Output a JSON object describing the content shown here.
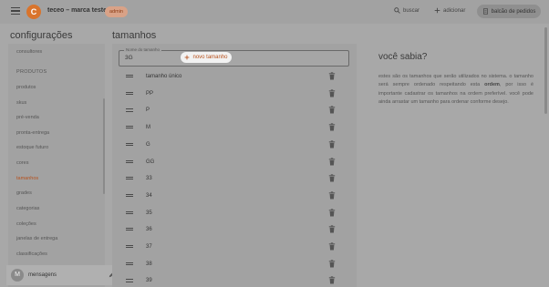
{
  "topbar": {
    "avatar_letter": "C",
    "store_name": "teceo – marca teste",
    "role_badge": "admin",
    "search_label": "buscar",
    "add_label": "adicionar",
    "store_button_label": "balcão de pedidos"
  },
  "sidebar": {
    "title": "configurações",
    "items_top": [
      {
        "label": "consultores"
      }
    ],
    "section_label": "PRODUTOS",
    "items": [
      {
        "label": "produtos"
      },
      {
        "label": "skus"
      },
      {
        "label": "pré-venda"
      },
      {
        "label": "pronta-entrega"
      },
      {
        "label": "estoque futuro"
      },
      {
        "label": "cores"
      },
      {
        "label": "tamanhos"
      },
      {
        "label": "grades"
      },
      {
        "label": "categorias"
      },
      {
        "label": "coleções"
      },
      {
        "label": "janelas de entrega"
      },
      {
        "label": "classificações"
      }
    ],
    "active_item": "tamanhos"
  },
  "messages": {
    "avatar_letter": "M",
    "label": "mensagens"
  },
  "main": {
    "title": "tamanhos",
    "field": {
      "label": "Nome do tamanho",
      "value": "3G"
    },
    "new_button_label": "novo tamanho",
    "rows": [
      {
        "label": "tamanho único"
      },
      {
        "label": "PP"
      },
      {
        "label": "P"
      },
      {
        "label": "M"
      },
      {
        "label": "G"
      },
      {
        "label": "GG"
      },
      {
        "label": "33"
      },
      {
        "label": "34"
      },
      {
        "label": "35"
      },
      {
        "label": "36"
      },
      {
        "label": "37"
      },
      {
        "label": "38"
      },
      {
        "label": "39"
      }
    ]
  },
  "info": {
    "title": "você sabia?",
    "text_1": "estes são os tamanhos que serão utilizados no sistema. o tamanho será sempre ordenado respeitando esta ",
    "text_bold": "ordem",
    "text_2": ", por isso é importante cadastrar os tamanhos na ordem preferível. você pode ainda arrastar um tamanho para ordenar conforme desejo."
  },
  "colors": {
    "accent": "#b6501c",
    "avatar": "#d9742c",
    "overlay_bg": "#a8a8a8"
  }
}
